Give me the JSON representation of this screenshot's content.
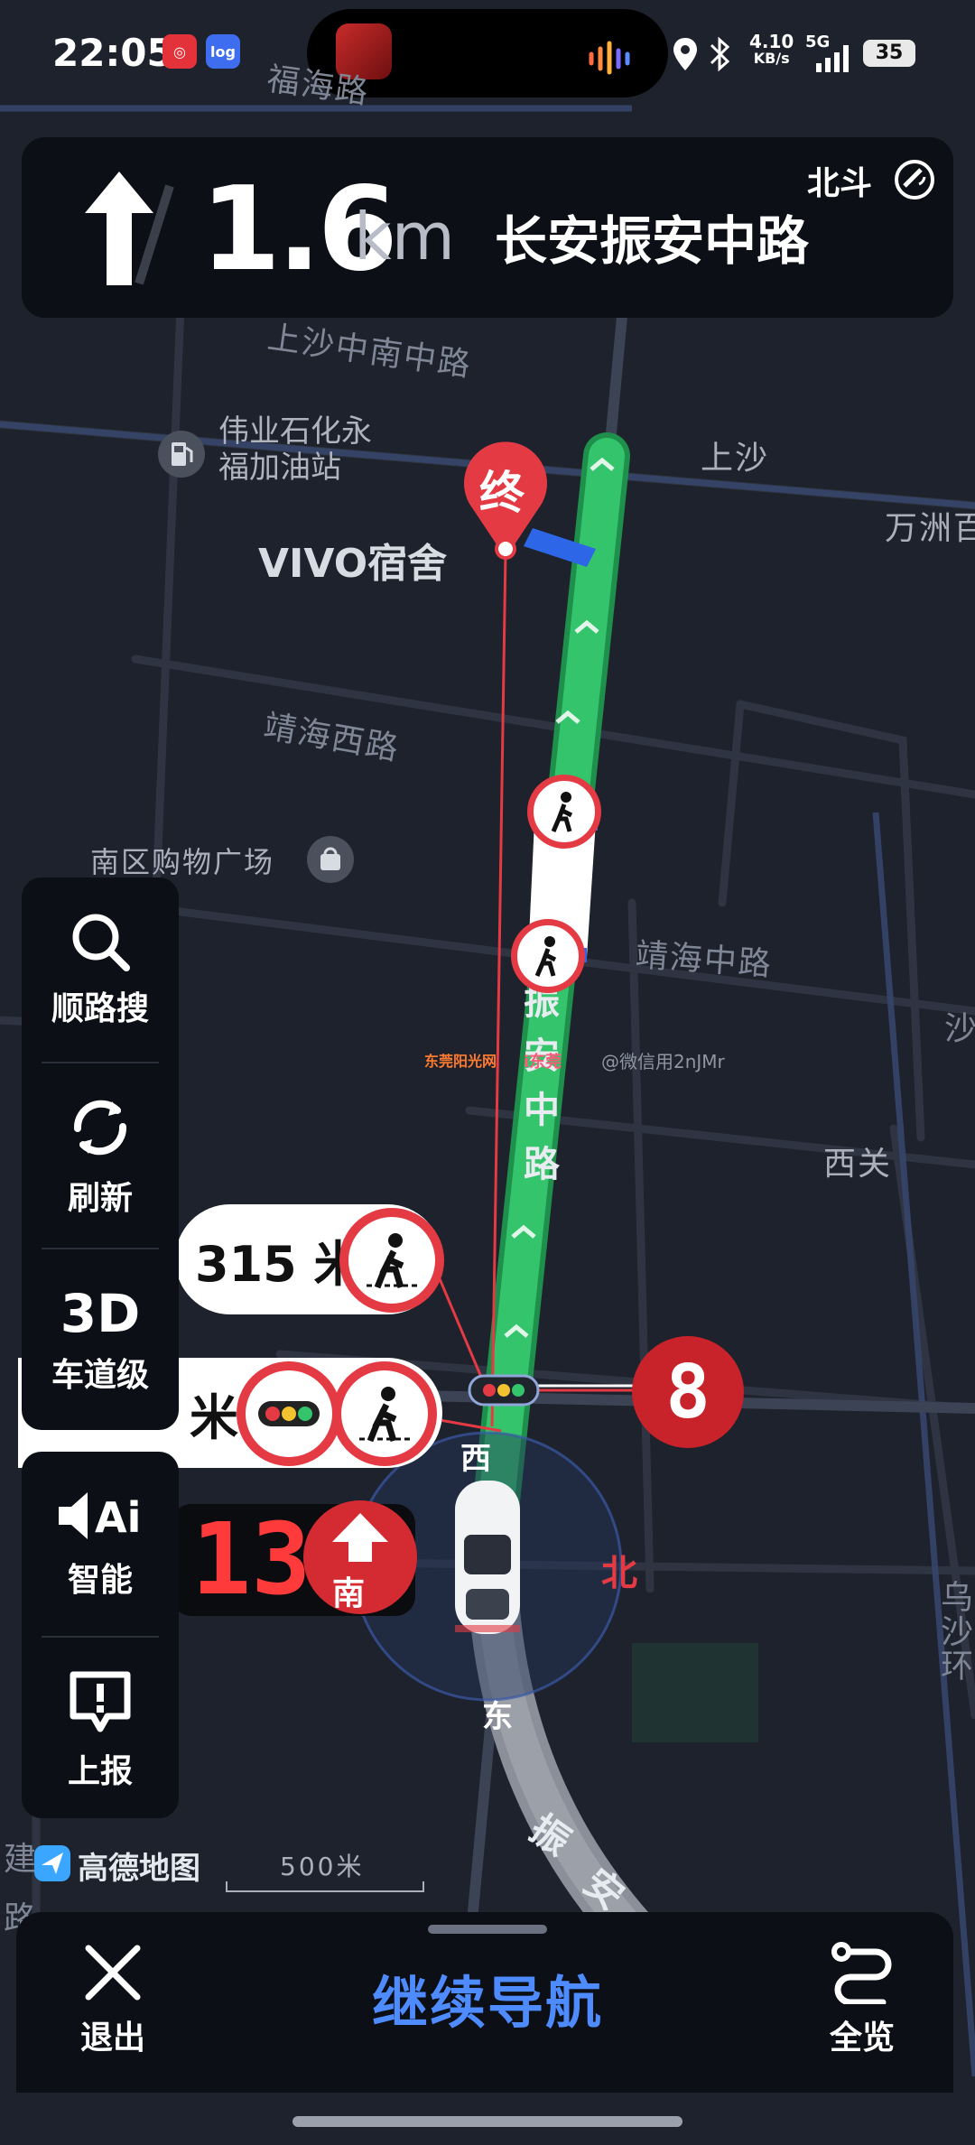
{
  "status_bar": {
    "time": "22:05",
    "app_badge_1": "◎",
    "app_badge_2": "log",
    "net_speed_value": "4.10",
    "net_speed_unit": "KB/s",
    "network": "5G",
    "battery": "35"
  },
  "guidance": {
    "maneuver_icon": "straight-arrow-icon",
    "distance_value": "1.6",
    "distance_unit": "km",
    "road_name": "长安振安中路",
    "positioning": "北斗"
  },
  "map": {
    "labels": {
      "road_fuhai": "福海路",
      "road_shangsha_south_middle": "上沙中南中路",
      "poi_gas_line1": "伟业石化永",
      "poi_gas_line2": "福加油站",
      "place_shangsha": "上沙",
      "place_wanzhou": "万洲百",
      "destination_name": "VIVO宿舍",
      "road_jinghai_west": "靖海西路",
      "poi_nanqu": "南区购物广场",
      "road_jinghai_middle": "靖海中路",
      "road_zhenan_1": "振",
      "road_zhenan_2": "安",
      "road_zhenan_3": "中",
      "road_zhenan_4": "路",
      "place_xiguan": "西关",
      "place_sha": "沙",
      "road_wusha": "乌沙环",
      "road_edge_jian": "建",
      "road_edge_lu": "路",
      "road_zhenan_lower_1": "振",
      "road_zhenan_lower_2": "安",
      "watermark_source": "东莞阳光网",
      "watermark_platform": "i东莞",
      "watermark_user": "@微信用2nJMr"
    },
    "destination_marker": "终",
    "compass": {
      "north": "北",
      "south": "南",
      "east": "东",
      "west": "西"
    }
  },
  "tools": [
    {
      "label": "顺路搜",
      "icon": "search-icon"
    },
    {
      "label": "刷新",
      "icon": "refresh-icon"
    },
    {
      "label": "车道级",
      "icon": "3d-icon",
      "big": "3D"
    },
    {
      "label": "智能",
      "icon": "ai-voice-icon"
    },
    {
      "label": "上报",
      "icon": "report-icon"
    }
  ],
  "callouts": {
    "crosswalk_distance": "315 米",
    "light_crosswalk_distance": "米",
    "light_countdown": "8",
    "straight_countdown": "13"
  },
  "bottom": {
    "logo_text": "高德地图",
    "scale_label": "500米",
    "exit_label": "退出",
    "continue_label": "继续导航",
    "overview_label": "全览"
  },
  "colors": {
    "route_green": "#33c46a",
    "route_blue": "#2e66e8",
    "accent_red": "#e43a44",
    "continue_blue": "#4d8bff"
  }
}
